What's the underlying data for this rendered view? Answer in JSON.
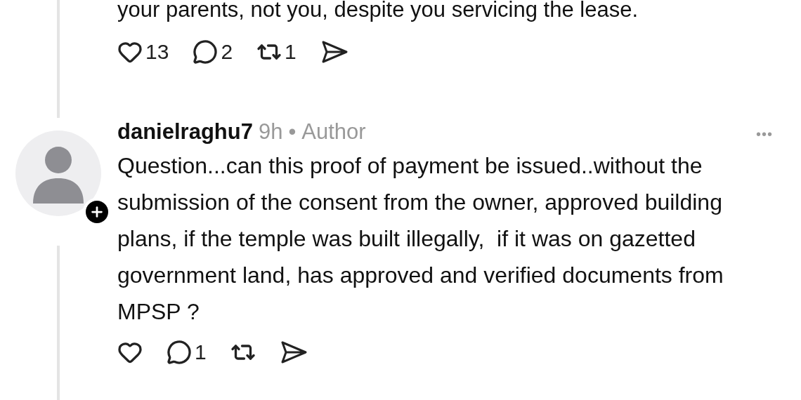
{
  "previous_post": {
    "text": "your parents, not you, despite you servicing the lease.",
    "actions": [
      {
        "kind": "like",
        "count": "13"
      },
      {
        "kind": "reply",
        "count": "2"
      },
      {
        "kind": "repost",
        "count": "1"
      },
      {
        "kind": "share"
      }
    ]
  },
  "reply": {
    "username": "danielraghu7",
    "time": "9h",
    "separator": "•",
    "role": "Author",
    "more": "•••",
    "body": "Question...can this proof of payment be issued..without the submission of the consent from the owner, approved building plans, if the temple was built illegally,  if it was on gazetted government land, has approved and verified documents from MPSP ?",
    "actions": [
      {
        "kind": "like"
      },
      {
        "kind": "reply",
        "count": "1"
      },
      {
        "kind": "repost"
      },
      {
        "kind": "share"
      }
    ]
  }
}
